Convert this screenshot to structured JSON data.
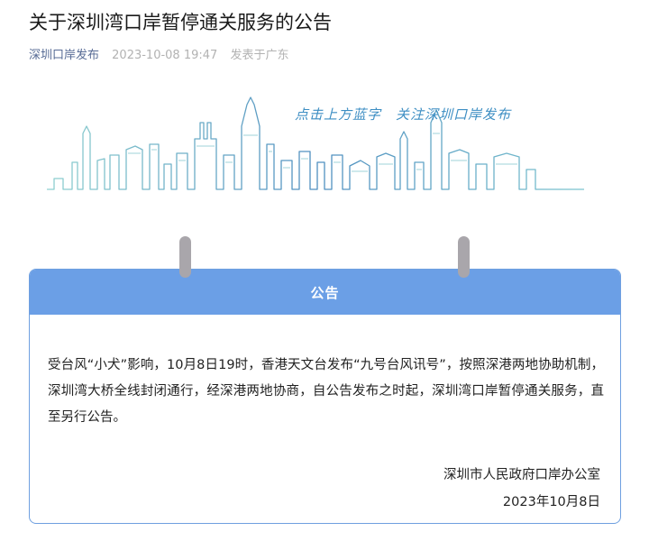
{
  "article": {
    "title": "关于深圳湾口岸暂停通关服务的公告",
    "account": "深圳口岸发布",
    "time": "2023-10-08 19:47",
    "location": "发表于广东"
  },
  "banner": {
    "slogan": "点击上方蓝字　关注深圳口岸发布"
  },
  "notice": {
    "header": "公告",
    "body": "受台风“小犬”影响，10月8日19时，香港天文台发布“九号台风讯号”，按照深港两地协助机制，深圳湾大桥全线封闭通行，经深港两地协商，自公告发布之时起，深圳湾口岸暂停通关服务，直至另行公告。",
    "issuer": "深圳市人民政府口岸办公室",
    "date": "2023年10月8日"
  },
  "colors": {
    "header_blue": "#6b9fe6",
    "account_link": "#576b95",
    "skyline_teal": "#5fb6c4"
  }
}
